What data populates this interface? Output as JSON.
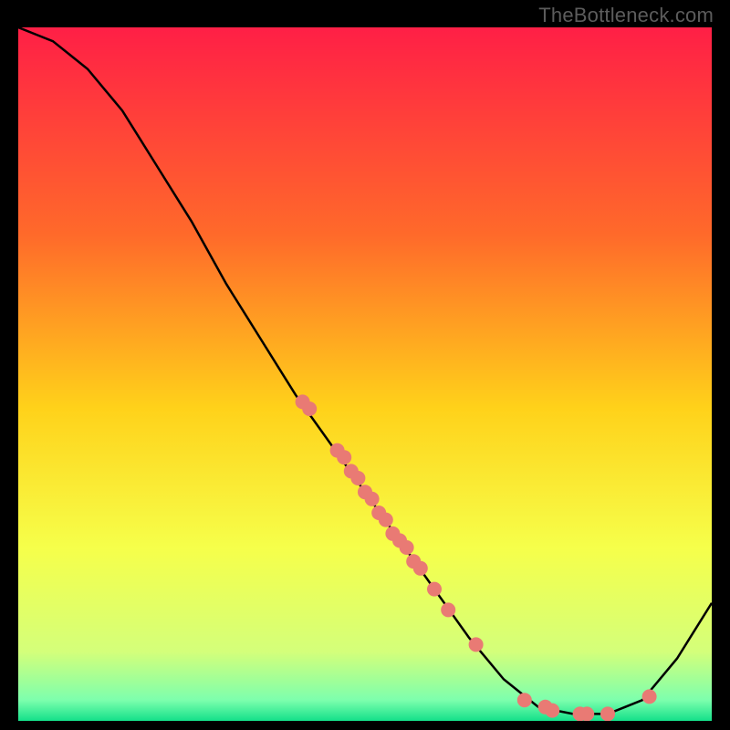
{
  "watermark": "TheBottleneck.com",
  "chart_data": {
    "type": "line",
    "title": "",
    "xlabel": "",
    "ylabel": "",
    "xlim": [
      0,
      100
    ],
    "ylim": [
      0,
      100
    ],
    "gradient_stops": [
      {
        "offset": 0,
        "color": "#ff1f46"
      },
      {
        "offset": 30,
        "color": "#ff6a2a"
      },
      {
        "offset": 55,
        "color": "#ffd21a"
      },
      {
        "offset": 75,
        "color": "#f6ff4a"
      },
      {
        "offset": 90,
        "color": "#d4ff7a"
      },
      {
        "offset": 97,
        "color": "#7dffad"
      },
      {
        "offset": 100,
        "color": "#14e08a"
      }
    ],
    "curve": [
      {
        "x": 0,
        "y": 100
      },
      {
        "x": 5,
        "y": 98
      },
      {
        "x": 10,
        "y": 94
      },
      {
        "x": 15,
        "y": 88
      },
      {
        "x": 20,
        "y": 80
      },
      {
        "x": 25,
        "y": 72
      },
      {
        "x": 30,
        "y": 63
      },
      {
        "x": 35,
        "y": 55
      },
      {
        "x": 40,
        "y": 47
      },
      {
        "x": 45,
        "y": 40
      },
      {
        "x": 50,
        "y": 33
      },
      {
        "x": 55,
        "y": 26
      },
      {
        "x": 60,
        "y": 19
      },
      {
        "x": 65,
        "y": 12
      },
      {
        "x": 70,
        "y": 6
      },
      {
        "x": 75,
        "y": 2
      },
      {
        "x": 80,
        "y": 1
      },
      {
        "x": 85,
        "y": 1
      },
      {
        "x": 90,
        "y": 3
      },
      {
        "x": 95,
        "y": 9
      },
      {
        "x": 100,
        "y": 17
      }
    ],
    "markers": [
      {
        "x": 41,
        "y": 46
      },
      {
        "x": 42,
        "y": 45
      },
      {
        "x": 46,
        "y": 39
      },
      {
        "x": 47,
        "y": 38
      },
      {
        "x": 48,
        "y": 36
      },
      {
        "x": 49,
        "y": 35
      },
      {
        "x": 50,
        "y": 33
      },
      {
        "x": 51,
        "y": 32
      },
      {
        "x": 52,
        "y": 30
      },
      {
        "x": 53,
        "y": 29
      },
      {
        "x": 54,
        "y": 27
      },
      {
        "x": 55,
        "y": 26
      },
      {
        "x": 56,
        "y": 25
      },
      {
        "x": 57,
        "y": 23
      },
      {
        "x": 58,
        "y": 22
      },
      {
        "x": 60,
        "y": 19
      },
      {
        "x": 62,
        "y": 16
      },
      {
        "x": 66,
        "y": 11
      },
      {
        "x": 73,
        "y": 3
      },
      {
        "x": 76,
        "y": 2
      },
      {
        "x": 77,
        "y": 1.5
      },
      {
        "x": 81,
        "y": 1
      },
      {
        "x": 82,
        "y": 1
      },
      {
        "x": 85,
        "y": 1
      },
      {
        "x": 91,
        "y": 3.5
      }
    ],
    "marker_color": "#e97a74",
    "marker_radius": 8,
    "curve_color": "#000000",
    "curve_width": 2.5
  }
}
